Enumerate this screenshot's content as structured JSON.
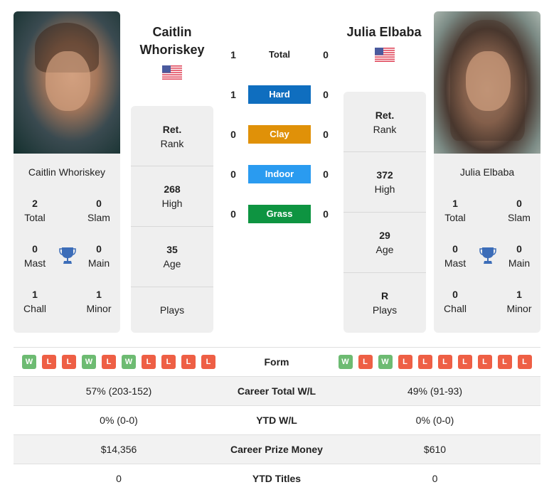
{
  "colors": {
    "hard": "#0f6ebf",
    "clay": "#e09108",
    "indoor": "#2a9bf0",
    "grass": "#0e9441",
    "win": "#6dbb72",
    "loss": "#ee5f45",
    "trophy": "#3c6db8"
  },
  "player1": {
    "name_line1": "Caitlin",
    "name_line2": "Whoriskey",
    "full_name": "Caitlin Whoriskey",
    "country_flag": "us-flag-icon",
    "titles": {
      "total": {
        "value": "2",
        "label": "Total"
      },
      "slam": {
        "value": "0",
        "label": "Slam"
      },
      "mast": {
        "value": "0",
        "label": "Mast"
      },
      "main": {
        "value": "0",
        "label": "Main"
      },
      "chall": {
        "value": "1",
        "label": "Chall"
      },
      "minor": {
        "value": "1",
        "label": "Minor"
      }
    },
    "info": [
      {
        "value": "Ret.",
        "label": "Rank"
      },
      {
        "value": "268",
        "label": "High"
      },
      {
        "value": "35",
        "label": "Age"
      },
      {
        "value": "",
        "label": "Plays"
      }
    ],
    "form": [
      "W",
      "L",
      "L",
      "W",
      "L",
      "W",
      "L",
      "L",
      "L",
      "L"
    ],
    "career_wl": "57% (203-152)",
    "ytd_wl": "0% (0-0)",
    "prize_money": "$14,356",
    "ytd_titles": "0"
  },
  "player2": {
    "name": "Julia Elbaba",
    "full_name": "Julia Elbaba",
    "country_flag": "us-flag-icon",
    "titles": {
      "total": {
        "value": "1",
        "label": "Total"
      },
      "slam": {
        "value": "0",
        "label": "Slam"
      },
      "mast": {
        "value": "0",
        "label": "Mast"
      },
      "main": {
        "value": "0",
        "label": "Main"
      },
      "chall": {
        "value": "0",
        "label": "Chall"
      },
      "minor": {
        "value": "1",
        "label": "Minor"
      }
    },
    "info": [
      {
        "value": "Ret.",
        "label": "Rank"
      },
      {
        "value": "372",
        "label": "High"
      },
      {
        "value": "29",
        "label": "Age"
      },
      {
        "value": "R",
        "label": "Plays"
      }
    ],
    "form": [
      "W",
      "L",
      "W",
      "L",
      "L",
      "L",
      "L",
      "L",
      "L",
      "L"
    ],
    "career_wl": "49% (91-93)",
    "ytd_wl": "0% (0-0)",
    "prize_money": "$610",
    "ytd_titles": "0"
  },
  "h2h": [
    {
      "label": "Total",
      "left": "1",
      "right": "0",
      "key": "total"
    },
    {
      "label": "Hard",
      "left": "1",
      "right": "0",
      "key": "hard"
    },
    {
      "label": "Clay",
      "left": "0",
      "right": "0",
      "key": "clay"
    },
    {
      "label": "Indoor",
      "left": "0",
      "right": "0",
      "key": "indoor"
    },
    {
      "label": "Grass",
      "left": "0",
      "right": "0",
      "key": "grass"
    }
  ],
  "table": {
    "form_label": "Form",
    "career_wl_label": "Career Total W/L",
    "ytd_wl_label": "YTD W/L",
    "prize_label": "Career Prize Money",
    "ytd_titles_label": "YTD Titles"
  }
}
